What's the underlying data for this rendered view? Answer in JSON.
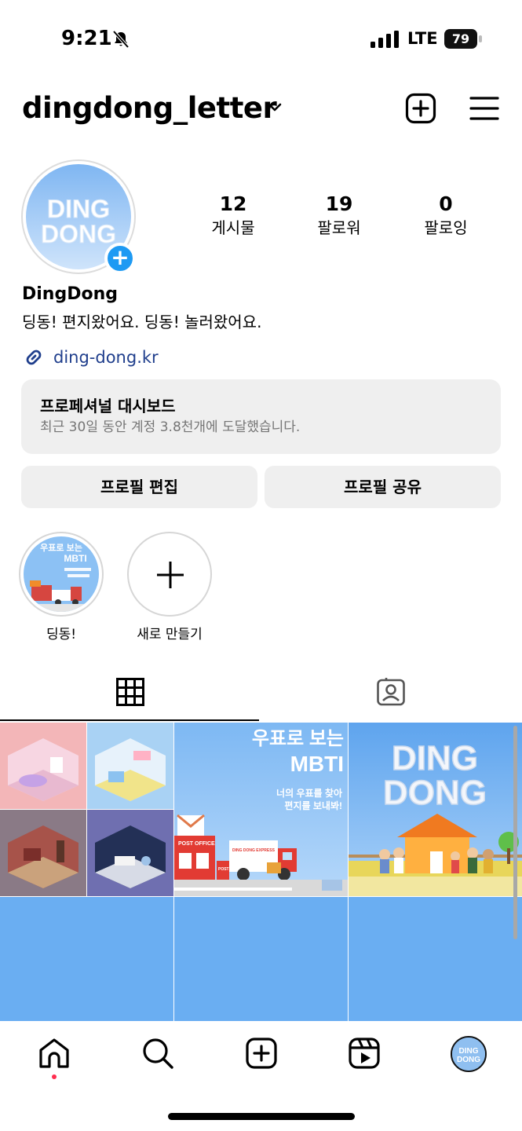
{
  "status_bar": {
    "time": "9:21",
    "network": "LTE",
    "battery": "79"
  },
  "header": {
    "username": "dingdong_letter"
  },
  "profile": {
    "avatar_text": "DING DONG",
    "stats": [
      {
        "value": "12",
        "label": "게시물"
      },
      {
        "value": "19",
        "label": "팔로워"
      },
      {
        "value": "0",
        "label": "팔로잉"
      }
    ],
    "display_name": "DingDong",
    "bio": "딩동! 편지왔어요. 딩동! 놀러왔어요.",
    "link": "ding-dong.kr"
  },
  "dashboard": {
    "title": "프로페셔널 대시보드",
    "subtitle": "최근 30일 동안 계정 3.8천개에 도달했습니다."
  },
  "buttons": {
    "edit_profile": "프로필 편집",
    "share_profile": "프로필 공유"
  },
  "highlights": [
    {
      "label": "딩동!",
      "cover_title": "우표로 보는",
      "cover_sub": "MBTI"
    },
    {
      "label": "새로 만들기"
    }
  ],
  "posts": [
    {
      "type": "rooms"
    },
    {
      "type": "mbti",
      "title1": "우표로 보는",
      "title2": "MBTI",
      "sub1": "너의 우표를 찾아",
      "sub2": "편지를 보내봐!",
      "truck": "DING DONG EXPRESS",
      "post_office": "POST OFFICE",
      "post": "POST"
    },
    {
      "type": "logo",
      "text1": "DING",
      "text2": "DONG"
    }
  ],
  "colors": {
    "accent_blue": "#1e9af3",
    "link": "#1f3e8c",
    "sky": "#6aaef2",
    "notification_dot": "#ff2d4f"
  }
}
